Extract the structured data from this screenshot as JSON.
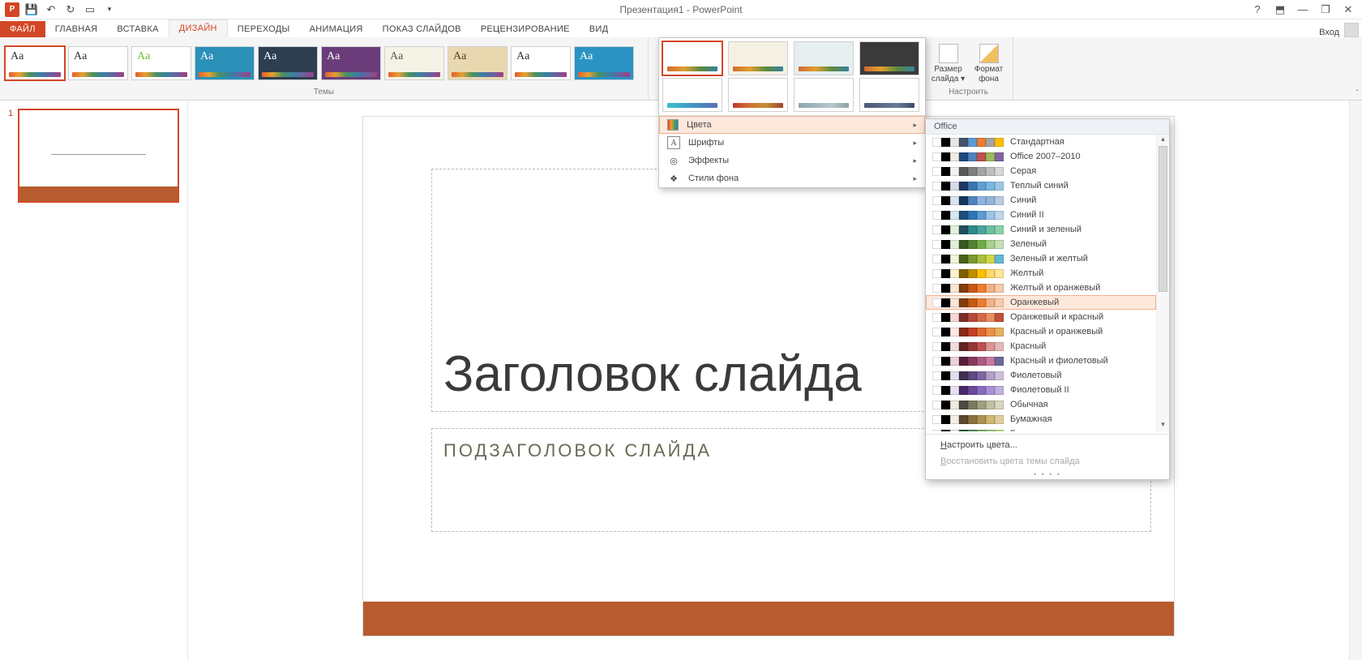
{
  "titlebar": {
    "title": "Презентация1 - PowerPoint",
    "signin": "Вход"
  },
  "tabs": {
    "file": "ФАЙЛ",
    "home": "ГЛАВНАЯ",
    "insert": "ВСТАВКА",
    "design": "ДИЗАЙН",
    "transitions": "ПЕРЕХОДЫ",
    "animations": "АНИМАЦИЯ",
    "slideshow": "ПОКАЗ СЛАЙДОВ",
    "review": "РЕЦЕНЗИРОВАНИЕ",
    "view": "ВИД"
  },
  "ribbon": {
    "themes_label": "Темы",
    "customize_label": "Настроить",
    "size_btn": "Размер\nслайда ▾",
    "format_btn": "Формат\nфона",
    "themes": [
      {
        "aa": "Aa",
        "fg": "#333",
        "bg": "#fff",
        "sel": true
      },
      {
        "aa": "Aa",
        "fg": "#333",
        "bg": "#fff"
      },
      {
        "aa": "Aa",
        "fg": "#6fbf3f",
        "bg": "#fff",
        "accent": "green"
      },
      {
        "aa": "Aa",
        "fg": "#fff",
        "bg": "#2a90b8",
        "accent": "diag"
      },
      {
        "aa": "Aa",
        "fg": "#fff",
        "bg": "#2d3e50"
      },
      {
        "aa": "Aa",
        "fg": "#fff",
        "bg": "#6a3d7a"
      },
      {
        "aa": "Aa",
        "fg": "#5a5a40",
        "bg": "#f5f3e6"
      },
      {
        "aa": "Aa",
        "fg": "#5a3a20",
        "bg": "#e8d8b0",
        "accent": "wood"
      },
      {
        "aa": "Aa",
        "fg": "#333",
        "bg": "#fff"
      },
      {
        "aa": "Aa",
        "fg": "#fff",
        "bg": "#2b93c4"
      }
    ],
    "variants": [
      {
        "bar": "linear-gradient(90deg,#d06a30,#e0a030,#5a8a40,#3a80a0)",
        "bg": "#fff",
        "sel": true
      },
      {
        "bar": "linear-gradient(90deg,#d06a30,#e0a030,#5a8a40,#3a80a0)",
        "bg": "#f5f0e4"
      },
      {
        "bar": "linear-gradient(90deg,#d06a30,#e0a030,#5a8a40,#3a80a0)",
        "bg": "#e6eef0"
      },
      {
        "bar": "linear-gradient(90deg,#d06a30,#e0a030,#5a8a40,#3a80a0)",
        "bg": "#3a3a3a"
      },
      {
        "bar": "linear-gradient(90deg,#3bbfc4,#40a4c8,#4a88c0,#5a70b8)",
        "bg": "#fff"
      },
      {
        "bar": "linear-gradient(90deg,#c03a30,#d07030,#c09030,#a04030)",
        "bg": "#fff"
      },
      {
        "bar": "linear-gradient(90deg,#8aa8b0,#a0b8c0,#b8c8cc,#90a0a8)",
        "bg": "#fff"
      },
      {
        "bar": "linear-gradient(90deg,#4a5a78,#5a6a88,#6a7a98,#3a4a68)",
        "bg": "#fff"
      }
    ]
  },
  "variants_menu": {
    "colors": "Цвета",
    "fonts": "Шрифты",
    "effects": "Эффекты",
    "bgstyles": "Стили фона",
    "u": {
      "fonts": "Ш",
      "bgstyles": "С"
    }
  },
  "colors_flyout": {
    "header": "Office",
    "schemes": [
      {
        "name": "Стандартная",
        "c": [
          "#ffffff",
          "#000000",
          "#e7e6e6",
          "#44546a",
          "#5b9bd5",
          "#ed7d31",
          "#a5a5a5",
          "#ffc000",
          "#4472c4",
          "#70ad47"
        ]
      },
      {
        "name": "Office 2007–2010",
        "c": [
          "#ffffff",
          "#000000",
          "#eeece1",
          "#1f497d",
          "#4f81bd",
          "#c0504d",
          "#9bbb59",
          "#8064a2",
          "#4bacc6",
          "#f79646"
        ]
      },
      {
        "name": "Серая",
        "c": [
          "#ffffff",
          "#000000",
          "#f2f2f2",
          "#595959",
          "#7f7f7f",
          "#a5a5a5",
          "#bfbfbf",
          "#d8d8d8",
          "#808080",
          "#404040"
        ]
      },
      {
        "name": "Теплый синий",
        "c": [
          "#ffffff",
          "#000000",
          "#d6dce5",
          "#1f3864",
          "#3b78b0",
          "#5fa0d8",
          "#7ab8e0",
          "#9cc8e8",
          "#385a82",
          "#203650"
        ]
      },
      {
        "name": "Синий",
        "c": [
          "#ffffff",
          "#000000",
          "#dbe5f1",
          "#17365d",
          "#4f81bd",
          "#8db3e2",
          "#95b3d7",
          "#b8cce4",
          "#366092",
          "#244061"
        ]
      },
      {
        "name": "Синий II",
        "c": [
          "#ffffff",
          "#000000",
          "#d6e8f0",
          "#1f4e79",
          "#2e75b6",
          "#5b9bd5",
          "#9cc3e5",
          "#bdd7ee",
          "#1f3864",
          "#0f243e"
        ]
      },
      {
        "name": "Синий и зеленый",
        "c": [
          "#ffffff",
          "#000000",
          "#e2efda",
          "#1f4e5f",
          "#2e8b8b",
          "#4aa5a0",
          "#6cbfa0",
          "#8cd0a8",
          "#3a7a6a",
          "#205040"
        ]
      },
      {
        "name": "Зеленый",
        "c": [
          "#ffffff",
          "#000000",
          "#e2f0d9",
          "#385723",
          "#548235",
          "#70ad47",
          "#a9d08e",
          "#c6e0b4",
          "#4a7a2a",
          "#2a4a18"
        ]
      },
      {
        "name": "Зеленый и желтый",
        "c": [
          "#ffffff",
          "#000000",
          "#eef5d8",
          "#4a6018",
          "#7a9a30",
          "#a8c040",
          "#d0d848",
          "#60b8d8",
          "#508830",
          "#305818"
        ]
      },
      {
        "name": "Желтый",
        "c": [
          "#ffffff",
          "#000000",
          "#fff2cc",
          "#7f6000",
          "#bf8f00",
          "#ffc000",
          "#ffd966",
          "#ffe699",
          "#a07000",
          "#604000"
        ]
      },
      {
        "name": "Желтый и оранжевый",
        "c": [
          "#ffffff",
          "#000000",
          "#fce4d6",
          "#833c0c",
          "#c65911",
          "#ed7d31",
          "#f4b084",
          "#f8cbad",
          "#a04000",
          "#602800"
        ]
      },
      {
        "name": "Оранжевый",
        "c": [
          "#ffffff",
          "#000000",
          "#fbe5d6",
          "#843c0c",
          "#c55a11",
          "#ed7d31",
          "#f4b183",
          "#f8cbad",
          "#a04a10",
          "#602a08"
        ],
        "hi": true
      },
      {
        "name": "Оранжевый и красный",
        "c": [
          "#ffffff",
          "#000000",
          "#f8d7d4",
          "#7b2d26",
          "#b84a3a",
          "#d86a4a",
          "#e89060",
          "#c05038",
          "#903828",
          "#602018"
        ]
      },
      {
        "name": "Красный и оранжевый",
        "c": [
          "#ffffff",
          "#000000",
          "#fce8e4",
          "#8a2a18",
          "#c04028",
          "#e06a30",
          "#f09048",
          "#e8b060",
          "#a03820",
          "#601c10"
        ]
      },
      {
        "name": "Красный",
        "c": [
          "#ffffff",
          "#000000",
          "#f2dcdb",
          "#632523",
          "#953734",
          "#c0504d",
          "#d99694",
          "#e6b8b7",
          "#802020",
          "#501010"
        ]
      },
      {
        "name": "Красный и фиолетовый",
        "c": [
          "#ffffff",
          "#000000",
          "#ead1dc",
          "#5b1e3a",
          "#8a3a5a",
          "#b05a80",
          "#c87aa0",
          "#706898",
          "#504878",
          "#302848"
        ]
      },
      {
        "name": "Фиолетовый",
        "c": [
          "#ffffff",
          "#000000",
          "#e4dfec",
          "#3f3151",
          "#604a7b",
          "#8064a2",
          "#b1a0c7",
          "#ccc0da",
          "#503a70",
          "#302040"
        ]
      },
      {
        "name": "Фиолетовый II",
        "c": [
          "#ffffff",
          "#000000",
          "#e8e0f0",
          "#4a2a6a",
          "#6a4a9a",
          "#8a6ac0",
          "#a890d8",
          "#c0b0e0",
          "#5a3a80",
          "#301850"
        ]
      },
      {
        "name": "Обычная",
        "c": [
          "#ffffff",
          "#000000",
          "#eeece1",
          "#4a4a40",
          "#7a7a60",
          "#a0a080",
          "#c0c0a0",
          "#d8d8c0",
          "#606050",
          "#383830"
        ]
      },
      {
        "name": "Бумажная",
        "c": [
          "#ffffff",
          "#000000",
          "#f4efe4",
          "#5a4a30",
          "#8a7040",
          "#b09050",
          "#d0b870",
          "#e0d0a0",
          "#706030",
          "#403818"
        ]
      },
      {
        "name": "Бегущая строка",
        "c": [
          "#ffffff",
          "#000000",
          "#e8f0e0",
          "#305838",
          "#4a8850",
          "#70b060",
          "#98c870",
          "#c0d880",
          "#406040",
          "#203820"
        ]
      }
    ],
    "customize": "Настроить цвета...",
    "customize_u": "Н",
    "reset": "Восстановить цвета темы слайда",
    "reset_u": "В"
  },
  "slide": {
    "num": "1",
    "title": "Заголовок слайда",
    "subtitle": "ПОДЗАГОЛОВОК СЛАЙДА"
  }
}
